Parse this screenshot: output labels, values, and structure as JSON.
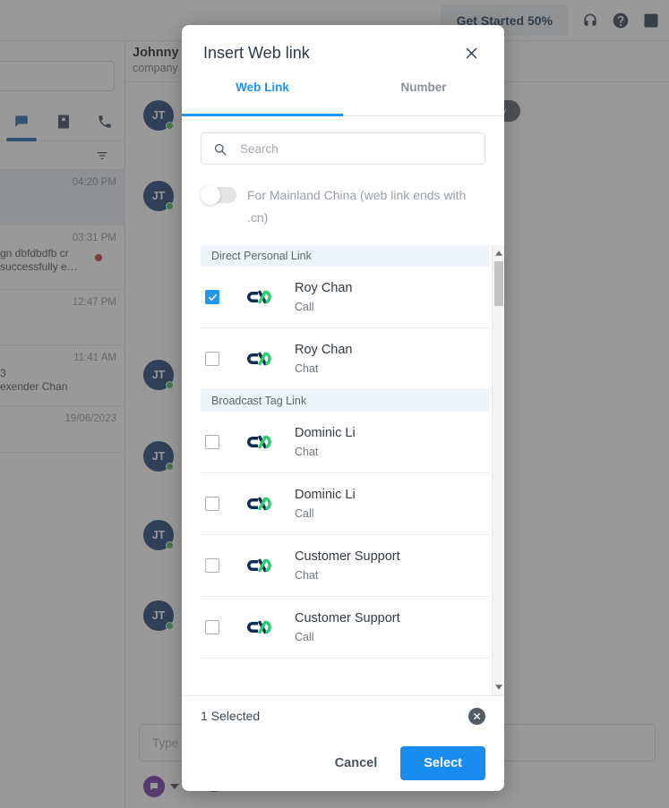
{
  "background": {
    "topbar": {
      "get_started_label": "Get Started 50%",
      "icons": [
        "headset-icon",
        "help-icon",
        "keypad-icon"
      ]
    },
    "left_panel": {
      "search_placeholder": "",
      "tabs": [
        {
          "name": "chat-tab",
          "icon": "chat-icon",
          "active": true
        },
        {
          "name": "contacts-tab",
          "icon": "contact-card-icon",
          "active": false
        },
        {
          "name": "calls-tab",
          "icon": "phone-icon",
          "active": false
        }
      ],
      "filter_icon": "filter-icon",
      "conversations": [
        {
          "time": "04:20 PM",
          "snippet": "",
          "unread": false
        },
        {
          "time": "03:31 PM",
          "snippet": "gn dbfdbdfb cr\nsuccessfully e…",
          "unread": true
        },
        {
          "time": "12:47 PM",
          "snippet": "",
          "unread": false
        },
        {
          "time": "11:41 AM",
          "snippet": "3\nexender Chan",
          "unread": false
        },
        {
          "time": "19/06/2023",
          "snippet": "",
          "unread": false
        }
      ]
    },
    "conversation_panel": {
      "contact_name": "Johnny T",
      "contact_sub": "company",
      "date_pill": "day",
      "avatar_initials": "JT",
      "composer_placeholder": "Type a",
      "channel_icon": "chat-bubble-icon",
      "new_button_icon": "plus-icon"
    }
  },
  "modal": {
    "title": "Insert Web link",
    "close_icon": "close-icon",
    "tabs": [
      {
        "label": "Web Link",
        "active": true
      },
      {
        "label": "Number",
        "active": false
      }
    ],
    "search": {
      "icon": "search-icon",
      "value": "",
      "placeholder": "Search"
    },
    "mainland_toggle": {
      "label": "For Mainland China (web link ends with .cn)",
      "enabled": false
    },
    "list": [
      {
        "type": "section",
        "label": "Direct Personal Link"
      },
      {
        "type": "item",
        "logo": "cx-logo-icon",
        "title": "Roy Chan",
        "subtitle": "Call",
        "checked": true
      },
      {
        "type": "item",
        "logo": "cx-logo-icon",
        "title": "Roy Chan",
        "subtitle": "Chat",
        "checked": false
      },
      {
        "type": "section",
        "label": "Broadcast Tag Link"
      },
      {
        "type": "item",
        "logo": "cx-logo-icon",
        "title": "Dominic Li",
        "subtitle": "Chat",
        "checked": false
      },
      {
        "type": "item",
        "logo": "cx-logo-icon",
        "title": "Dominic Li",
        "subtitle": "Call",
        "checked": false
      },
      {
        "type": "item",
        "logo": "cx-logo-icon",
        "title": "Customer Support",
        "subtitle": "Chat",
        "checked": false
      },
      {
        "type": "item",
        "logo": "cx-logo-icon",
        "title": "Customer Support",
        "subtitle": "Call",
        "checked": false
      }
    ],
    "footer": {
      "selected_count_label": "1 Selected",
      "clear_icon": "clear-selection-icon",
      "cancel_label": "Cancel",
      "select_label": "Select"
    }
  },
  "colors": {
    "accent_blue": "#2196f3",
    "primary_button": "#1a8cf0",
    "section_header_bg": "#eef4f9",
    "logo_navy": "#0d2d52",
    "logo_green": "#2ecc71",
    "unread_red": "#c62828",
    "presence_green": "#4caf50",
    "avatar_navy": "#173a6d"
  }
}
